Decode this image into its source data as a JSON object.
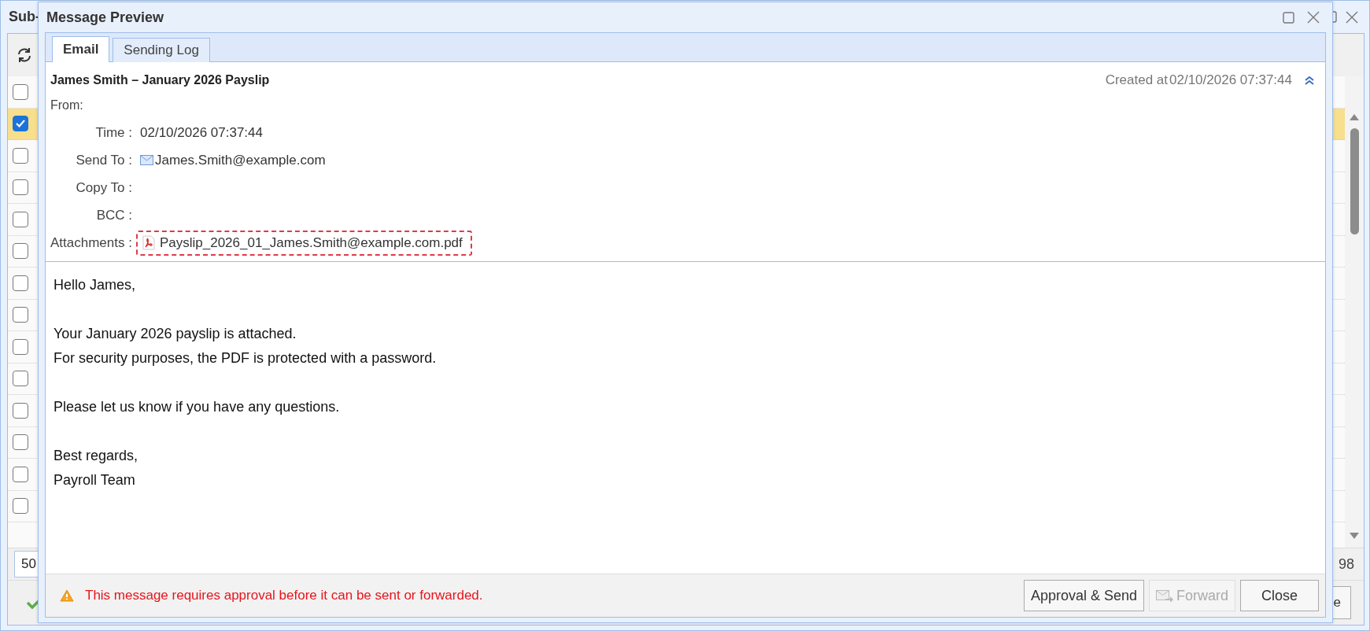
{
  "background_window": {
    "title": "Sub-",
    "rows": [
      {
        "checked": false
      },
      {
        "checked": true
      },
      {
        "checked": false
      },
      {
        "checked": false
      },
      {
        "checked": false
      },
      {
        "checked": false
      },
      {
        "checked": false
      },
      {
        "checked": false
      },
      {
        "checked": false
      },
      {
        "checked": false
      },
      {
        "checked": false
      },
      {
        "checked": false
      },
      {
        "checked": false
      },
      {
        "checked": false
      }
    ],
    "page_size": "50",
    "page_info": "98",
    "button_label": "e"
  },
  "dialog": {
    "title": "Message Preview",
    "tabs": [
      {
        "label": "Email",
        "selected": true
      },
      {
        "label": "Sending Log",
        "selected": false
      }
    ],
    "subject": "James Smith – January 2026 Payslip",
    "created_label": "Created at",
    "created_value": "02/10/2026 07:37:44",
    "from_label": "From:",
    "fields": [
      {
        "kind": "text",
        "label": "Time :",
        "value": "02/10/2026 07:37:44"
      },
      {
        "kind": "email",
        "label": "Send To :",
        "value": "James.Smith@example.com"
      },
      {
        "kind": "text",
        "label": "Copy To :"
      },
      {
        "kind": "text",
        "label": "BCC :"
      },
      {
        "kind": "attachment",
        "label": "Attachments :",
        "value": "Payslip_2026_01_James.Smith@example.com.pdf"
      }
    ],
    "body": [
      [
        "Hello James,"
      ],
      [
        "Your January 2026 payslip is attached.",
        "For security purposes, the PDF is protected with a password."
      ],
      [
        "Please let us know if you have any questions."
      ],
      [
        "Best regards,",
        "Payroll Team"
      ]
    ],
    "warning": "This message requires approval before it can be sent or forwarded.",
    "buttons": [
      {
        "kind": "plain",
        "label": "Approval & Send",
        "disabled": false
      },
      {
        "kind": "forward",
        "label": "Forward",
        "disabled": true
      },
      {
        "kind": "plain",
        "label": "Close",
        "disabled": false
      }
    ]
  }
}
